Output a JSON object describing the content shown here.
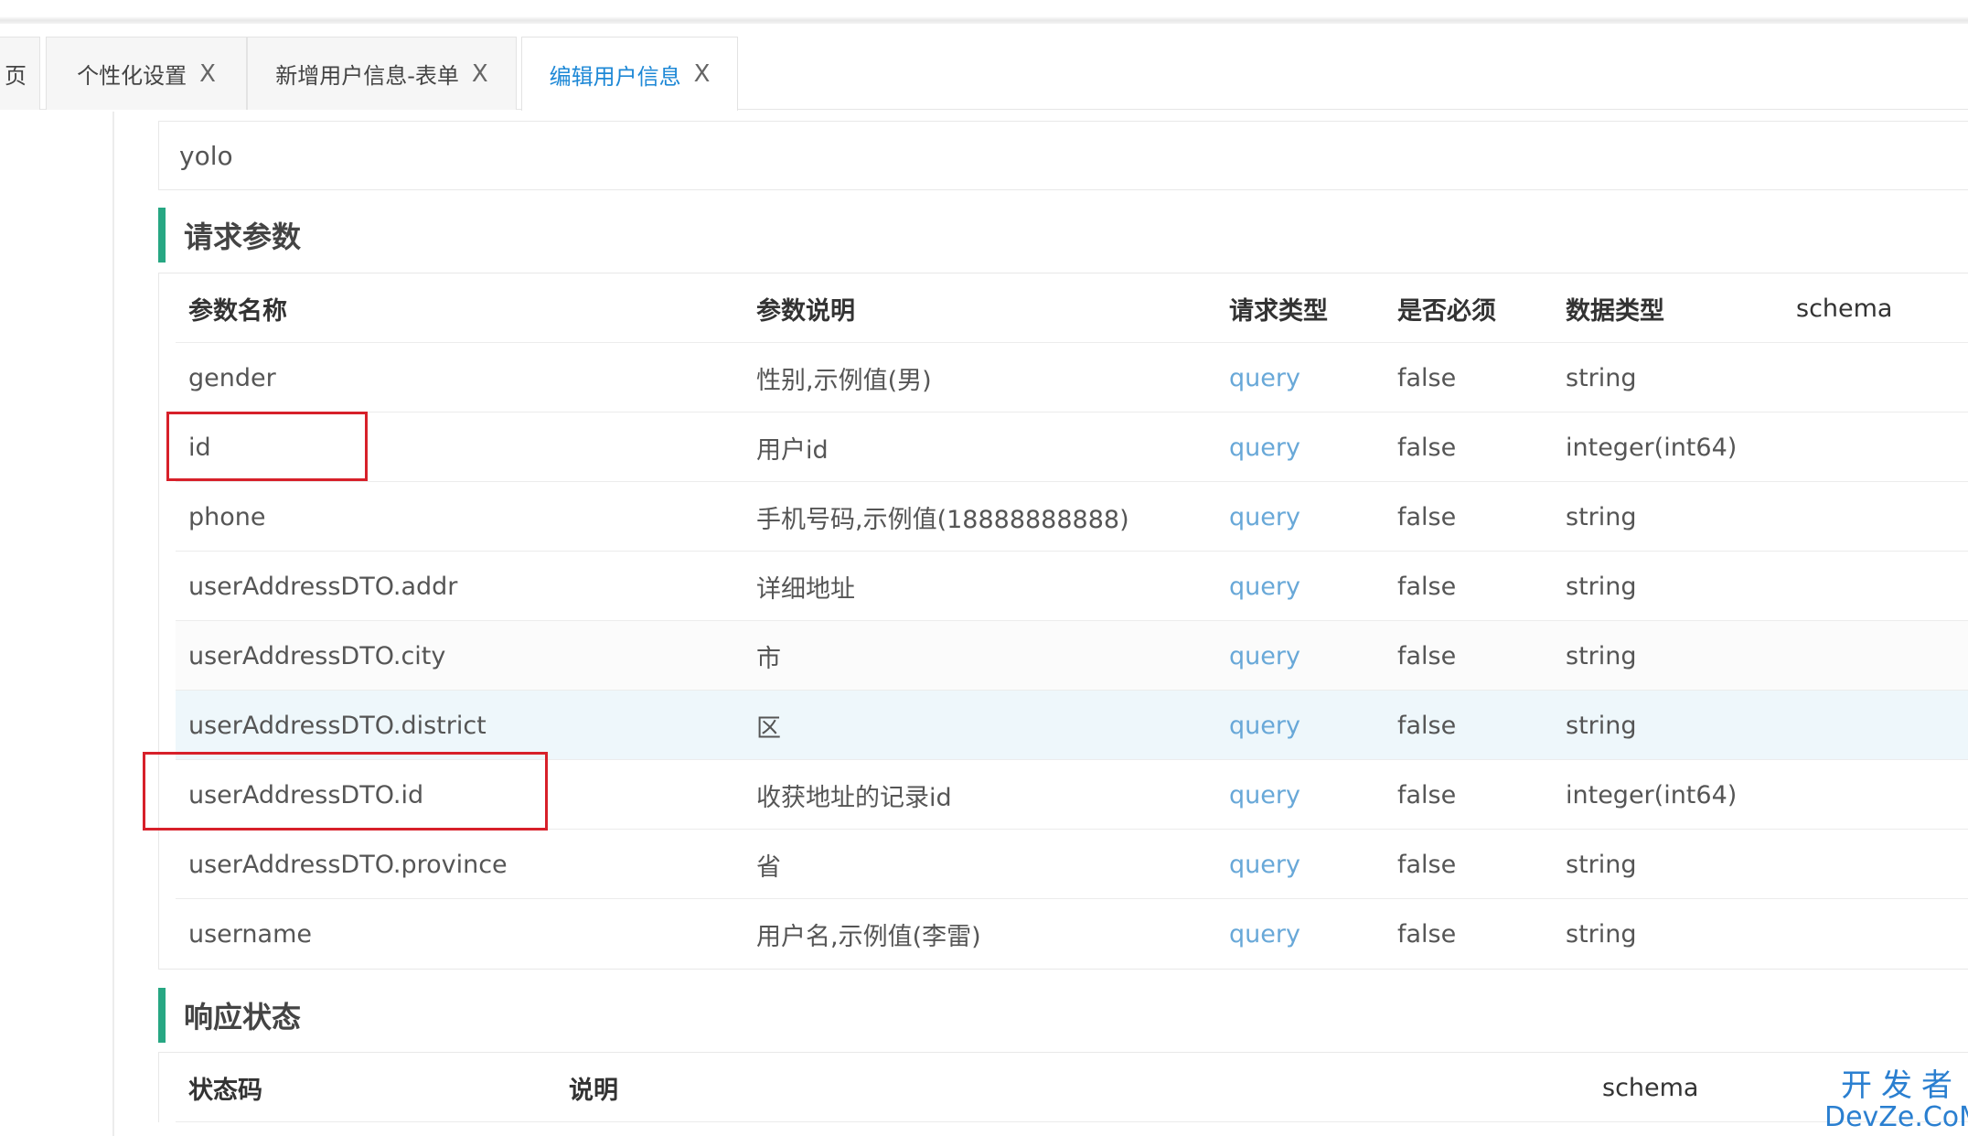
{
  "tabs": [
    {
      "label": "页",
      "close": ""
    },
    {
      "label": "个性化设置",
      "close": "X"
    },
    {
      "label": "新增用户信息-表单",
      "close": "X"
    },
    {
      "label": "编辑用户信息",
      "close": "X",
      "active": true
    }
  ],
  "description": "yolo",
  "request_section": {
    "title": "请求参数",
    "columns": [
      "参数名称",
      "参数说明",
      "请求类型",
      "是否必须",
      "数据类型",
      "schema"
    ],
    "rows": [
      {
        "name": "gender",
        "desc": "性别,示例值(男)",
        "in": "query",
        "required": "false",
        "type": "string"
      },
      {
        "name": "id",
        "desc": "用户id",
        "in": "query",
        "required": "false",
        "type": "integer(int64)"
      },
      {
        "name": "phone",
        "desc": "手机号码,示例值(18888888888)",
        "in": "query",
        "required": "false",
        "type": "string"
      },
      {
        "name": "userAddressDTO.addr",
        "desc": "详细地址",
        "in": "query",
        "required": "false",
        "type": "string"
      },
      {
        "name": "userAddressDTO.city",
        "desc": "市",
        "in": "query",
        "required": "false",
        "type": "string"
      },
      {
        "name": "userAddressDTO.district",
        "desc": "区",
        "in": "query",
        "required": "false",
        "type": "string"
      },
      {
        "name": "userAddressDTO.id",
        "desc": "收获地址的记录id",
        "in": "query",
        "required": "false",
        "type": "integer(int64)"
      },
      {
        "name": "userAddressDTO.province",
        "desc": "省",
        "in": "query",
        "required": "false",
        "type": "string"
      },
      {
        "name": "username",
        "desc": "用户名,示例值(李雷)",
        "in": "query",
        "required": "false",
        "type": "string"
      }
    ]
  },
  "response_section": {
    "title": "响应状态",
    "columns": [
      "状态码",
      "说明",
      "schema"
    ]
  },
  "watermark": {
    "cn": "开发者",
    "en": "DevZe.CoM"
  },
  "colors": {
    "accent_bar": "#27a783",
    "active_tab": "#1e88d6",
    "query_text": "#68a8d8",
    "annotation_box": "#d7202a"
  }
}
